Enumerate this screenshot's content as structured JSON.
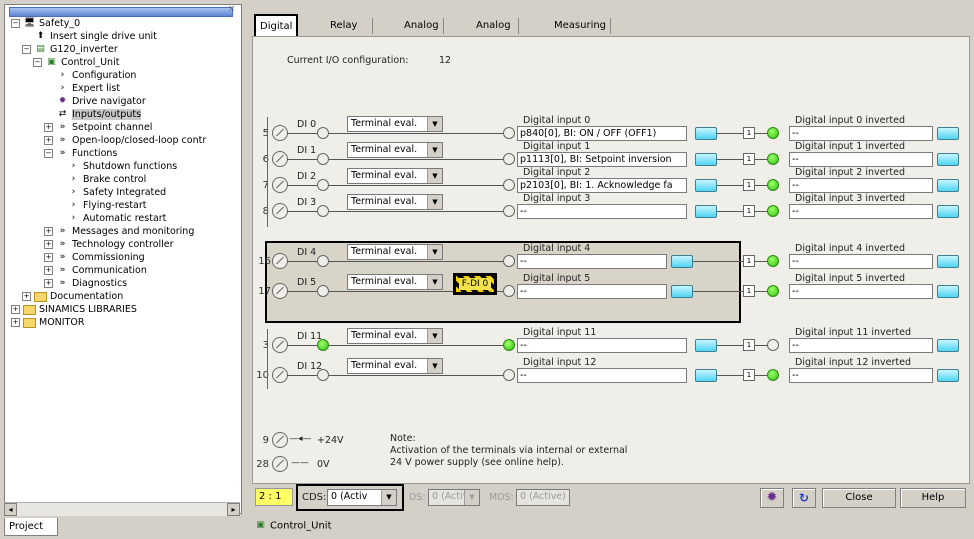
{
  "tree": {
    "items": [
      {
        "label": "Safety_0",
        "toggle": "−",
        "icon": "project-icon",
        "indent": 0
      },
      {
        "label": "Insert single drive unit",
        "toggle": "",
        "icon": "insert-device-icon",
        "indent": 1
      },
      {
        "label": "G120_inverter",
        "toggle": "−",
        "icon": "drive-icon",
        "indent": 1
      },
      {
        "label": "Control_Unit",
        "toggle": "−",
        "icon": "control-unit-icon",
        "indent": 2
      },
      {
        "label": "Configuration",
        "toggle": "",
        "icon": "chevron-icon",
        "indent": 3
      },
      {
        "label": "Expert list",
        "toggle": "",
        "icon": "chevron-icon",
        "indent": 3
      },
      {
        "label": "Drive navigator",
        "toggle": "",
        "icon": "navigator-icon",
        "indent": 3
      },
      {
        "label": "Inputs/outputs",
        "toggle": "",
        "icon": "io-icon",
        "indent": 3
      },
      {
        "label": "Setpoint channel",
        "toggle": "+",
        "icon": "double-chevron-icon",
        "indent": 3
      },
      {
        "label": "Open-loop/closed-loop contr",
        "toggle": "+",
        "icon": "double-chevron-icon",
        "indent": 3
      },
      {
        "label": "Functions",
        "toggle": "−",
        "icon": "double-chevron-icon",
        "indent": 3
      },
      {
        "label": "Shutdown functions",
        "toggle": "",
        "icon": "chevron-icon",
        "indent": 4
      },
      {
        "label": "Brake control",
        "toggle": "",
        "icon": "chevron-icon",
        "indent": 4
      },
      {
        "label": "Safety Integrated",
        "toggle": "",
        "icon": "chevron-icon",
        "indent": 4
      },
      {
        "label": "Flying-restart",
        "toggle": "",
        "icon": "chevron-icon",
        "indent": 4
      },
      {
        "label": "Automatic restart",
        "toggle": "",
        "icon": "chevron-icon",
        "indent": 4
      },
      {
        "label": "Messages and monitoring",
        "toggle": "+",
        "icon": "double-chevron-icon",
        "indent": 3
      },
      {
        "label": "Technology controller",
        "toggle": "+",
        "icon": "double-chevron-icon",
        "indent": 3
      },
      {
        "label": "Commissioning",
        "toggle": "+",
        "icon": "double-chevron-icon",
        "indent": 3
      },
      {
        "label": "Communication",
        "toggle": "+",
        "icon": "double-chevron-icon",
        "indent": 3
      },
      {
        "label": "Diagnostics",
        "toggle": "+",
        "icon": "double-chevron-icon",
        "indent": 3
      },
      {
        "label": "Documentation",
        "toggle": "+",
        "icon": "folder-icon",
        "indent": 1
      },
      {
        "label": "SINAMICS LIBRARIES",
        "toggle": "+",
        "icon": "folder-icon",
        "indent": 0
      },
      {
        "label": "MONITOR",
        "toggle": "+",
        "icon": "folder-icon",
        "indent": 0
      }
    ],
    "project_tab": "Project"
  },
  "tabs": [
    "Digital inputs",
    "Relay outputs",
    "Analog inputs",
    "Analog outputs",
    "Measuring Input"
  ],
  "config": {
    "label": "Current I/O configuration:",
    "value": "12"
  },
  "inputs": [
    {
      "pin": "5",
      "name": "DI 0",
      "eval": "Terminal eval.",
      "title": "Digital input 0",
      "value": "p840[0], BI: ON / OFF (OFF1)",
      "inv_title": "Digital input 0 inverted",
      "inv_value": "--",
      "left_green": false,
      "right_green": true
    },
    {
      "pin": "6",
      "name": "DI 1",
      "eval": "Terminal eval.",
      "title": "Digital input 1",
      "value": "p1113[0], BI: Setpoint inversion",
      "inv_title": "Digital input 1 inverted",
      "inv_value": "--",
      "left_green": false,
      "right_green": true
    },
    {
      "pin": "7",
      "name": "DI 2",
      "eval": "Terminal eval.",
      "title": "Digital input 2",
      "value": "p2103[0], BI: 1. Acknowledge fa",
      "inv_title": "Digital input 2 inverted",
      "inv_value": "--",
      "left_green": false,
      "right_green": true
    },
    {
      "pin": "8",
      "name": "DI 3",
      "eval": "Terminal eval.",
      "title": "Digital input 3",
      "value": "--",
      "inv_title": "Digital input 3 inverted",
      "inv_value": "--",
      "left_green": false,
      "right_green": true
    },
    {
      "pin": "16",
      "name": "DI 4",
      "eval": "Terminal eval.",
      "title": "Digital input 4",
      "value": "--",
      "inv_title": "Digital input 4 inverted",
      "inv_value": "--",
      "left_green": false,
      "right_green": true
    },
    {
      "pin": "17",
      "name": "DI 5",
      "eval": "Terminal eval.",
      "title": "Digital input 5",
      "value": "--",
      "inv_title": "Digital input 5 inverted",
      "inv_value": "--",
      "left_green": false,
      "right_green": true
    },
    {
      "pin": "3",
      "name": "DI 11",
      "eval": "Terminal eval.",
      "title": "Digital input 11",
      "value": "--",
      "inv_title": "Digital input 11 inverted",
      "inv_value": "--",
      "left_green": true,
      "right_green": false
    },
    {
      "pin": "10",
      "name": "DI 12",
      "eval": "Terminal eval.",
      "title": "Digital input 12",
      "value": "--",
      "inv_title": "Digital input 12 inverted",
      "inv_value": "--",
      "left_green": false,
      "right_green": true
    }
  ],
  "fdi_label": "F-DI 0",
  "one_label": "1",
  "power": [
    {
      "pin": "9",
      "label": "+24V"
    },
    {
      "pin": "28",
      "label": "0V"
    }
  ],
  "note": {
    "title": "Note:",
    "line1": "Activation of the terminals via internal or external",
    "line2": "24 V power supply (see online help)."
  },
  "bottom": {
    "counter": "2 : 1",
    "cds_label": "CDS:",
    "cds_value": "0 (Activ",
    "ds_label": "DS:",
    "ds_value": "0 (Activ",
    "mds_label": "MDS:",
    "mds_value": "0 (Active)",
    "close": "Close",
    "help": "Help",
    "status_tab": "Control_Unit"
  },
  "colors": {
    "accent_yellow": "#f4e24a",
    "led_green": "#2fbf12",
    "button_cyan": "#4fd4f2"
  }
}
